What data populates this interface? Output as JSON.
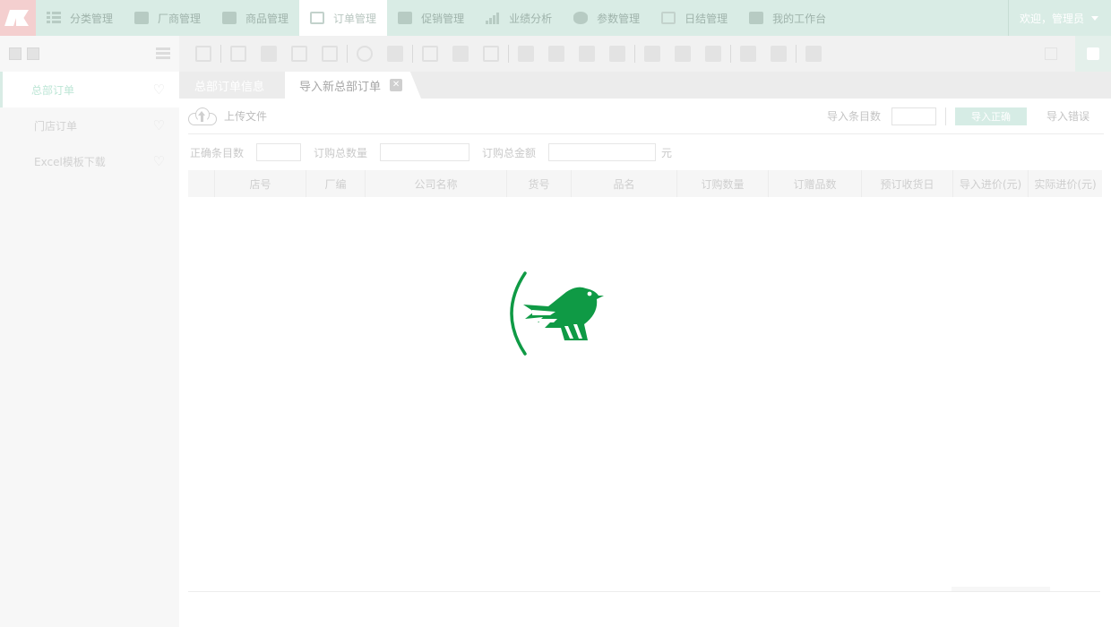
{
  "nav": {
    "items": [
      {
        "label": "分类管理",
        "icon": "list-icon"
      },
      {
        "label": "厂商管理",
        "icon": "truck-icon"
      },
      {
        "label": "商品管理",
        "icon": "gift-icon"
      },
      {
        "label": "订单管理",
        "icon": "order-icon"
      },
      {
        "label": "促销管理",
        "icon": "tag-icon"
      },
      {
        "label": "业绩分析",
        "icon": "bar-chart-icon"
      },
      {
        "label": "参数管理",
        "icon": "database-icon"
      },
      {
        "label": "日结管理",
        "icon": "calendar-icon"
      },
      {
        "label": "我的工作台",
        "icon": "briefcase-icon"
      }
    ],
    "active_index": 3,
    "user": "欢迎，管理员"
  },
  "sidebar": {
    "items": [
      {
        "label": "总部订单"
      },
      {
        "label": "门店订单"
      },
      {
        "label": "Excel模板下载"
      }
    ],
    "active_index": 0
  },
  "tabs": [
    {
      "label": "总部订单信息"
    },
    {
      "label": "导入新总部订单"
    }
  ],
  "upload": {
    "label": "上传文件",
    "import_count_label": "导入条目数",
    "import_correct_btn": "导入正确",
    "import_error_btn": "导入错误"
  },
  "filters": {
    "correct_count_label": "正确条目数",
    "total_qty_label": "订购总数量",
    "total_amount_label": "订购总金额",
    "unit": "元"
  },
  "table": {
    "columns": [
      "店号",
      "厂编",
      "公司名称",
      "货号",
      "品名",
      "订购数量",
      "订赠品数",
      "预订收货日",
      "导入进价(元)",
      "实际进价(元)"
    ]
  },
  "colors": {
    "nav_bg": "#d9ece5",
    "loader_green": "#0f9a45",
    "logo_bg": "#f4cfcf"
  }
}
